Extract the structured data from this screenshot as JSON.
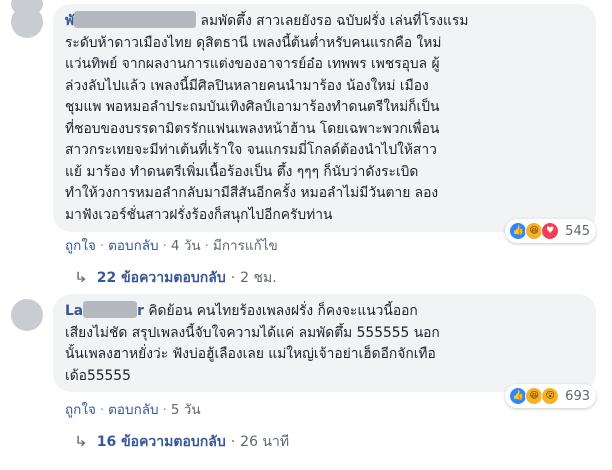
{
  "comments": [
    {
      "author": "พั",
      "lines": [
        "ลมพัดตึ้ง สาวเลยยังรอ ฉบับฝรั่ง เล่นที่โรงแรม",
        "ระดับห้าดาวเมืองไทย ดุสิตธานี เพลงนี้ต้นต่ำหรับคนแรกคือ ใหม่",
        "แว่นทิพย์ จากผลงานการแต่งของอาจารย์อ๋อ เทพพร เพชรอุบล ผู้",
        "ล่วงลับไปแล้ว เพลงนี้มีศิลปินหลายคนนำมาร้อง น้องใหม่ เมือง",
        "ชุมแพ พอหมอลำประถมบันเทิงศิลป์เอามาร้องทำดนตรีใหม่ก็เป็น",
        "ที่ชอบของบรรดามิตรรักแฟนเพลงหน้าฮ้าน โดยเฉพาะพวกเพื่อน",
        "สาวกระเทยจะมีท่าเต้นที่เร้าใจ จนแกรมมี่โกลด์ต้องนำไปให้สาว",
        "แย้ มาร้อง ทำดนตรีเพิ่มเนื้อร้องเป็น ตึ้ง ๆๆๆ ก็นับว่าดังระเบิด",
        "ทำให้วงการหมอลำกลับมามีสีสันอีกครั้ง หมอลำไม่มีวันตาย ลอง",
        "มาฟังเวอร์ชั่นสาวฝรั่งร้องก็สนุกไปอีกครับท่าน"
      ],
      "reaction_count": "545",
      "reactions": [
        "like",
        "haha",
        "love"
      ],
      "actions": {
        "like": "ถูกใจ",
        "reply": "ตอบกลับ",
        "time": "4 วัน",
        "edited": "มีการแก้ไข"
      },
      "reply_link": "22 ข้อความตอบกลับ",
      "reply_time": "2 ชม."
    },
    {
      "author": "La",
      "author_tail": "r",
      "lines": [
        "คิดย้อน คนไทยร้องเพลงฝรั่ง ก็คงจะแนวนี้ออก",
        "เสียงไม่ชัด สรุปเพลงนี้จับใจความได้แค่ ลมพัดตึ้ม 555555 นอก",
        "นั้นเพลงฮาหยั่งว่ะ ฟังบ่อฮู้เลืองเลย แม่ใหญ่เจ้าอย่าเฮ็ดอีกจักเทือ",
        "เด้อ55555"
      ],
      "reaction_count": "693",
      "reactions": [
        "like",
        "haha",
        "wow"
      ],
      "actions": {
        "like": "ถูกใจ",
        "reply": "ตอบกลับ",
        "time": "5 วัน"
      },
      "reply_link": "16 ข้อความตอบกลับ",
      "reply_time": "26 นาที"
    }
  ],
  "icons": {
    "separator": "·",
    "reply_arrow": "↳"
  },
  "colors": {
    "link": "#385898",
    "bubble": "#f2f3f5",
    "meta": "#606770"
  }
}
